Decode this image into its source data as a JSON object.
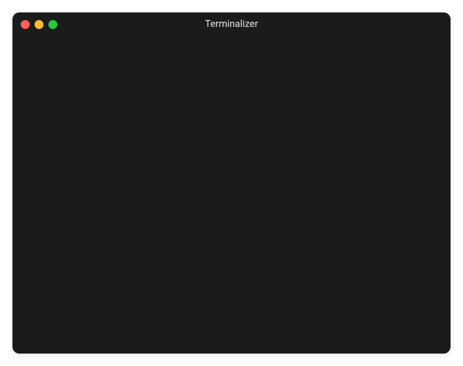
{
  "window": {
    "title": "Terminalizer"
  },
  "traffic_lights": {
    "close": "close",
    "minimize": "minimize",
    "maximize": "maximize"
  }
}
